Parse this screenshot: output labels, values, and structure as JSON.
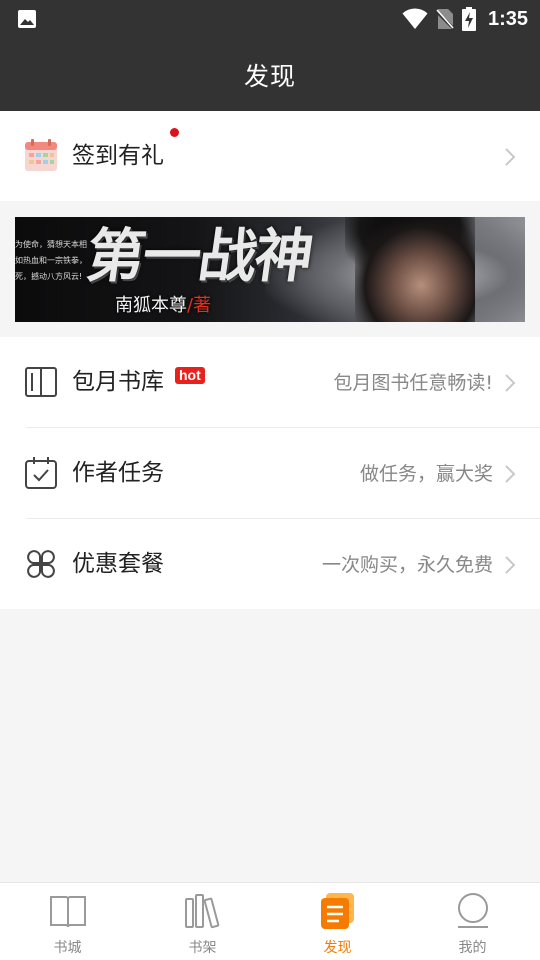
{
  "status_bar": {
    "time": "1:35",
    "icons": [
      "image-icon",
      "wifi-icon",
      "no-sim-icon",
      "battery-charging-icon"
    ]
  },
  "header": {
    "title": "发现"
  },
  "checkin": {
    "label": "签到有礼",
    "icon": "calendar-icon",
    "has_notification_dot": true
  },
  "banner": {
    "side_text": [
      "为使命，猜想天本相",
      "如热血和一宗铁拳，",
      "死，撼动八方风云!"
    ],
    "title": "第一战神",
    "author": "南狐本尊",
    "author_suffix": "/著"
  },
  "menu": {
    "items": [
      {
        "label": "包月书库",
        "badge": "hot",
        "desc": "包月图书任意畅读!",
        "icon": "book-open-icon"
      },
      {
        "label": "作者任务",
        "desc": "做任务，赢大奖",
        "icon": "calendar-check-icon"
      },
      {
        "label": "优惠套餐",
        "desc": "一次购买，永久免费",
        "icon": "clover-icon"
      }
    ]
  },
  "tabbar": {
    "tabs": [
      {
        "label": "书城",
        "icon": "book-icon",
        "active": false
      },
      {
        "label": "书架",
        "icon": "bookshelf-icon",
        "active": false
      },
      {
        "label": "发现",
        "icon": "discover-icon",
        "active": true
      },
      {
        "label": "我的",
        "icon": "profile-icon",
        "active": false
      }
    ]
  },
  "colors": {
    "header_bg": "#333333",
    "accent": "#f57c00",
    "badge_red": "#e8211d",
    "text_secondary": "#888888"
  }
}
